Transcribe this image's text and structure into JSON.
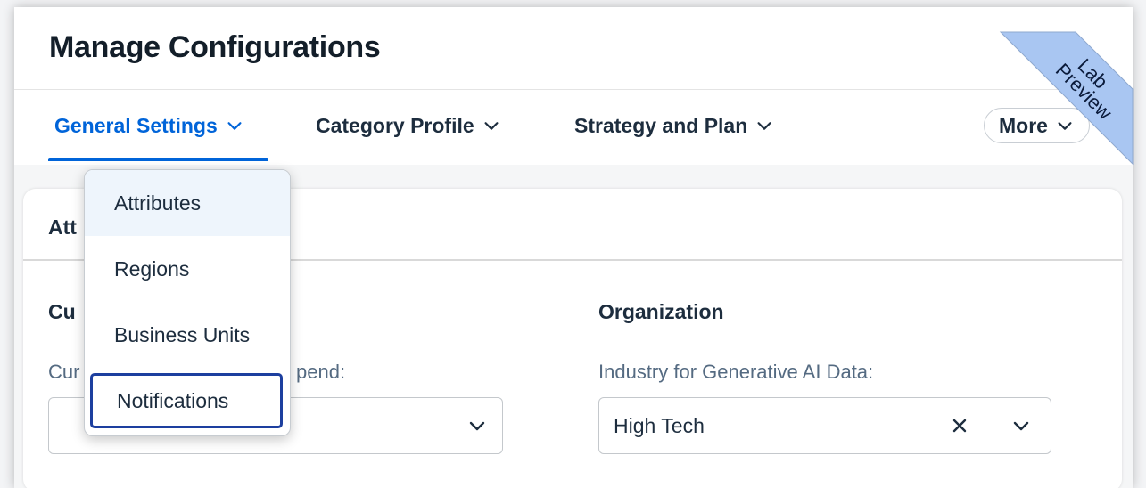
{
  "page": {
    "title": "Manage Configurations"
  },
  "tabs": [
    {
      "label": "General Settings",
      "active": true
    },
    {
      "label": "Category Profile",
      "active": false
    },
    {
      "label": "Strategy and Plan",
      "active": false
    }
  ],
  "more_button": {
    "label": "More"
  },
  "card": {
    "title_visible": "Att"
  },
  "sections": {
    "currency": {
      "title_visible": "Cu",
      "label_prefix": "Cur",
      "label_suffix": "pend:"
    },
    "organization": {
      "title": "Organization",
      "label": "Industry for Generative AI Data:",
      "value": "High Tech"
    }
  },
  "dropdown_menu": {
    "items": [
      {
        "label": "Attributes",
        "state": "hover"
      },
      {
        "label": "Regions",
        "state": "normal"
      },
      {
        "label": "Business Units",
        "state": "normal"
      },
      {
        "label": "Notifications",
        "state": "focused"
      }
    ]
  },
  "ribbon": {
    "line1": "Lab",
    "line2": "Preview",
    "color": "#a9c6f2"
  },
  "colors": {
    "accent": "#0064d9",
    "focus_border": "#1d3f9f"
  },
  "icons": {
    "tab_chevron": "chevron-down-icon",
    "clear": "close-icon",
    "dropdown": "chevron-down-icon"
  }
}
